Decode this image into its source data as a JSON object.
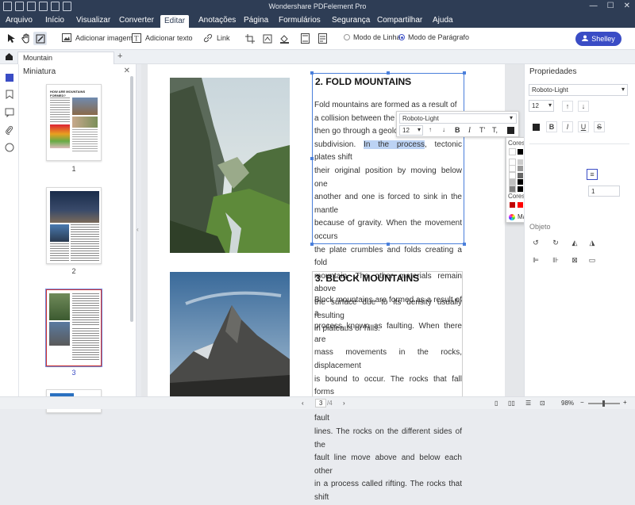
{
  "app": {
    "title": "Wondershare PDFelement Pro"
  },
  "window_controls": [
    "—",
    "☐",
    "✕"
  ],
  "menu": [
    "Arquivo",
    "Início",
    "Visualizar",
    "Converter",
    "Editar",
    "Anotações",
    "Página",
    "Formulários",
    "Segurança",
    "Compartilhar",
    "Ajuda"
  ],
  "menu_active": "Editar",
  "toolbar": {
    "add_image": "Adicionar imagem",
    "add_text": "Adicionar texto",
    "link": "Link",
    "line_mode": "Modo de Linha",
    "paragraph_mode": "Modo de Parágrafo",
    "selected_mode": "paragraph"
  },
  "user": {
    "name": "Shelley"
  },
  "tab": {
    "name": "Mountain",
    "add": "+"
  },
  "thumbnails": {
    "title": "Miniatura",
    "close": "✕",
    "pages": [
      "1",
      "2",
      "3"
    ],
    "selected": "3",
    "thumb1_title": "HOW ARE MOUNTAINS FORMED?"
  },
  "doc": {
    "heading1": "2. FOLD MOUNTAINS",
    "para1": [
      "Fold mountains are formed as a result of",
      "a collision between the tecto",
      "then go through a geologic",
      "subdivision. In the process, tectonic plates shift",
      "their original position by moving below one",
      "another and one is forced to sink in the mantle",
      "because of gravity. When the movement occurs",
      "the plate crumbles and folds creating a fold",
      "mountain. The other materials remain above",
      "the surface due to its density usually resulting",
      "in plateaus or hills."
    ],
    "selected_text": "In the process",
    "heading2": "3. BLOCK MOUNTAINS",
    "para2": [
      "Block mountains are formed as a result of a",
      "process known as faulting. When there are",
      "mass movements in the rocks, displacement",
      "is bound to occur. The rocks that fall forms",
      "cracks between the rocks also known as fault",
      "lines. The rocks on the different sides of the",
      "fault line move above and below each other",
      "in a process called rifting. The rocks that shift"
    ]
  },
  "format_bar": {
    "font": "Roboto-Light",
    "size": "12"
  },
  "color_picker": {
    "theme_label": "Cores do Tema",
    "standard_label": "Cores Padrão",
    "more_label": "Mais Cores",
    "theme_top": [
      "#ffffff",
      "#000000",
      "#e7e6e6",
      "#44546a",
      "#4472c4",
      "#ed7d31",
      "#a5a5a5",
      "#ffc000",
      "#5b9bd5",
      "#70ad47"
    ],
    "standard": [
      "#c00000",
      "#ff0000",
      "#ffc000",
      "#ffff00",
      "#92d050",
      "#00b050",
      "#00b0f0",
      "#0070c0",
      "#002060",
      "#7030a0"
    ]
  },
  "properties": {
    "title": "Propriedades",
    "font": "Roboto-Light",
    "size": "12",
    "object_label": "Objeto",
    "spacing": "1"
  },
  "status": {
    "page": "3",
    "total": "/4",
    "zoom": "98%"
  },
  "colors": {
    "titlebar": "#2e3d55",
    "accent": "#3a4cc5",
    "selection": "#bcd3f4"
  }
}
